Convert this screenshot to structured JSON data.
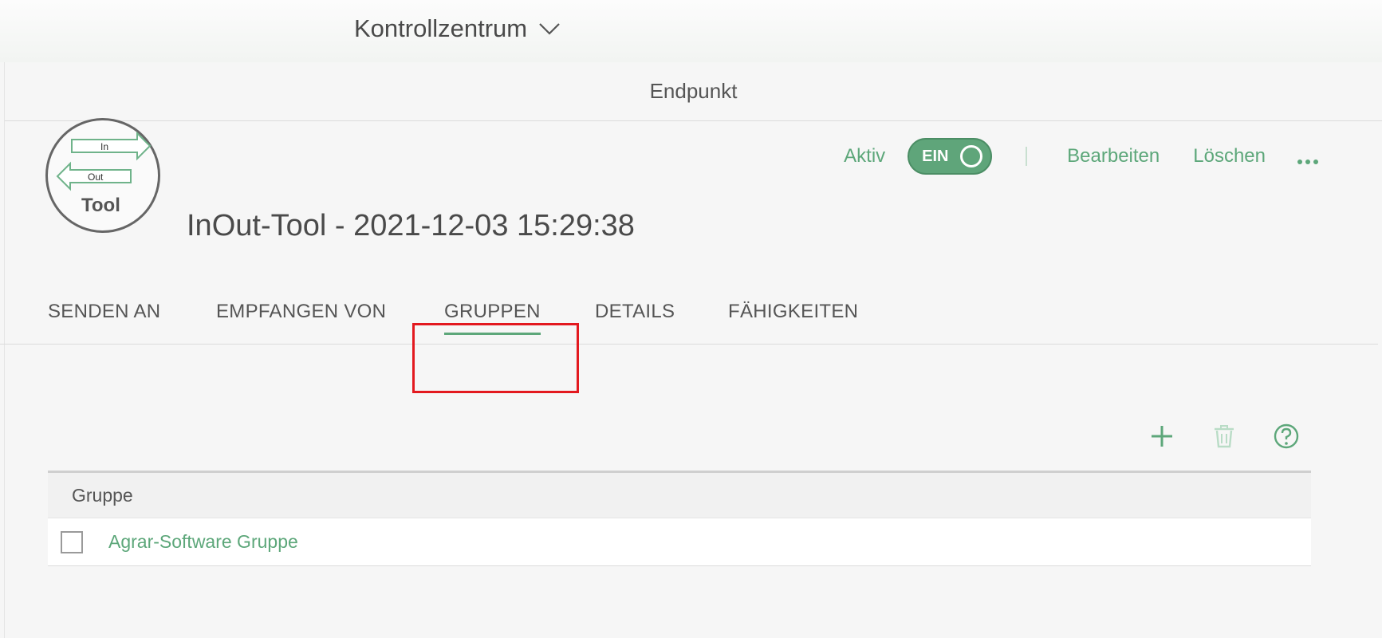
{
  "topbar": {
    "menu_label": "Kontrollzentrum"
  },
  "panel": {
    "header_title": "Endpunkt"
  },
  "actions": {
    "active_label": "Aktiv",
    "toggle_label": "EIN",
    "toggle_on": true,
    "edit_label": "Bearbeiten",
    "delete_label": "Löschen"
  },
  "logo": {
    "arrow_in": "In",
    "arrow_out": "Out",
    "tool": "Tool"
  },
  "endpoint": {
    "title": "InOut-Tool - 2021-12-03 15:29:38"
  },
  "tabs": [
    {
      "label": "SENDEN AN",
      "active": false
    },
    {
      "label": "EMPFANGEN VON",
      "active": false
    },
    {
      "label": "GRUPPEN",
      "active": true
    },
    {
      "label": "DETAILS",
      "active": false
    },
    {
      "label": "FÄHIGKEITEN",
      "active": false
    }
  ],
  "table": {
    "column_header": "Gruppe",
    "rows": [
      {
        "name": "Agrar-Software Gruppe",
        "checked": false
      }
    ]
  },
  "icons": [
    "chevron-down-icon",
    "more-dots-icon",
    "plus-icon",
    "trash-icon",
    "help-icon"
  ],
  "colors": {
    "accent": "#5da77a",
    "highlight": "#e3191f"
  }
}
